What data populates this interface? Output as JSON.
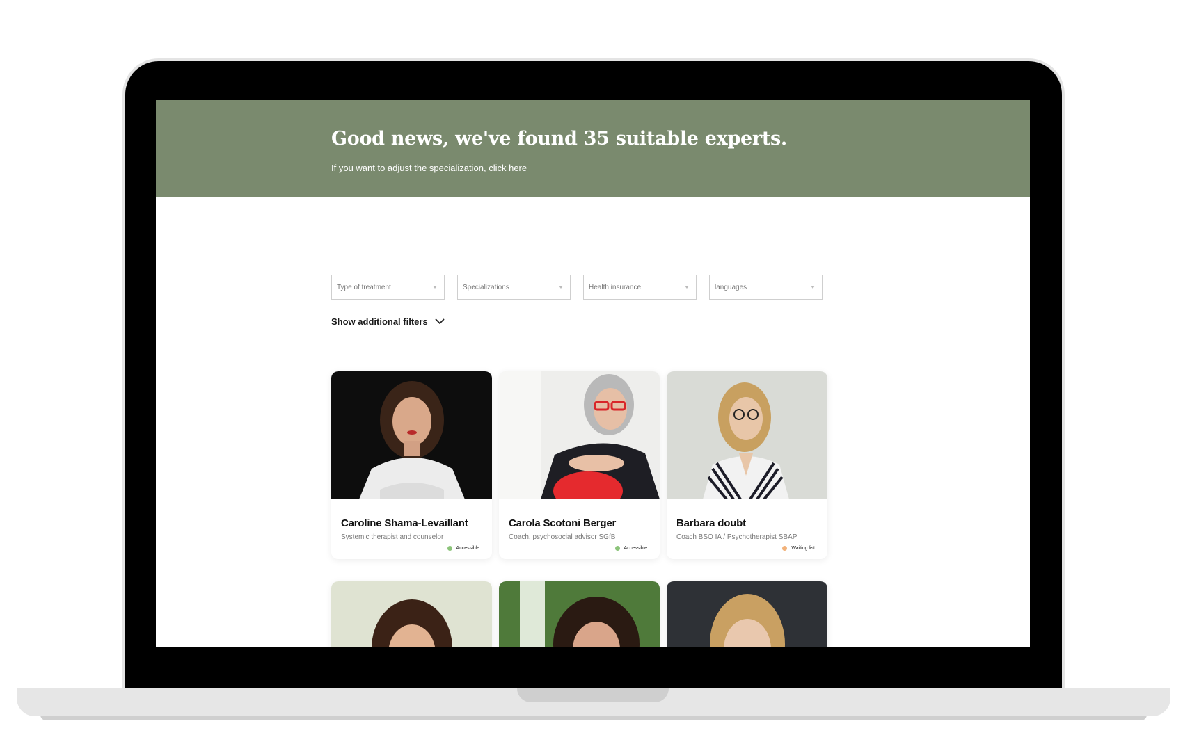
{
  "hero": {
    "title": "Good news, we've found 35 suitable experts.",
    "subtitle": "If you want to adjust the specialization,",
    "link": "click here",
    "background_color": "#7a8a6e"
  },
  "filters": {
    "type_of_treatment": "Type of treatment",
    "specializations": "Specializations",
    "health_insurance": "Health insurance",
    "languages": "languages"
  },
  "additional_filters": {
    "label": "Show additional filters",
    "icon": "chevron-down-icon"
  },
  "status_colors": {
    "accessible": "#8cc47a",
    "waiting": "#f2b27a"
  },
  "experts": [
    {
      "name": "Caroline Shama-Levaillant",
      "role": "Systemic therapist and counselor",
      "status": "Accessible",
      "status_kind": "accessible"
    },
    {
      "name": "Carola Scotoni Berger",
      "role": "Coach, psychosocial advisor SGfB",
      "status": "Accessible",
      "status_kind": "accessible"
    },
    {
      "name": "Barbara doubt",
      "role": "Coach BSO IA / Psychotherapist SBAP",
      "status": "Waiting list",
      "status_kind": "waiting"
    }
  ]
}
